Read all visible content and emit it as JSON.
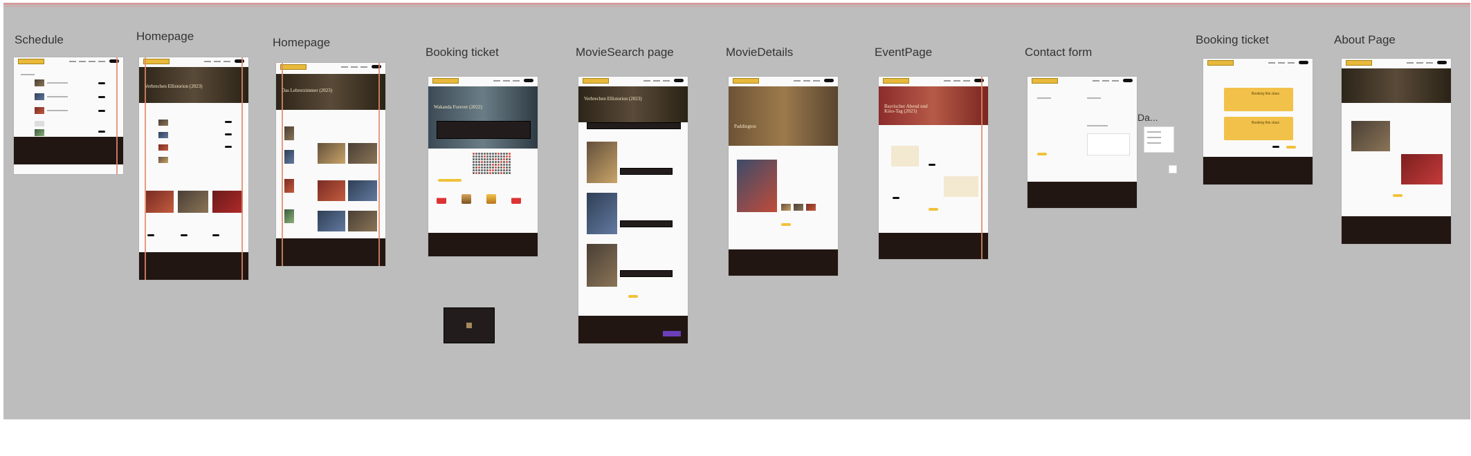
{
  "canvas": {
    "background": "#bdbdbd",
    "guide_color": "#e08a6a",
    "accent": "#f0c23a",
    "footer_color": "#221613"
  },
  "frames": [
    {
      "id": "schedule",
      "label": "Schedule"
    },
    {
      "id": "homepage-1",
      "label": "Homepage"
    },
    {
      "id": "homepage-2",
      "label": "Homepage"
    },
    {
      "id": "booking-1",
      "label": "Booking ticket"
    },
    {
      "id": "movie-search",
      "label": "MovieSearch page"
    },
    {
      "id": "movie-details",
      "label": "MovieDetails"
    },
    {
      "id": "event-page",
      "label": "EventPage"
    },
    {
      "id": "contact-form",
      "label": "Contact form"
    },
    {
      "id": "data",
      "label": "Da..."
    },
    {
      "id": "booking-2",
      "label": "Booking ticket"
    },
    {
      "id": "about",
      "label": "About Page"
    }
  ],
  "hero_titles": {
    "homepage_1": "Verbrechen Ellistorion (2023)",
    "homepage_2": "Das Lehrerzimmer (2023)",
    "booking_1": "Wakanda Forever (2022)",
    "movie_search": "Verbrechen Ellistorion (2023)",
    "movie_details": "Paddington",
    "event_page": "Bayrischer Abend und Kino-Tag (2023)"
  },
  "booking_2_tickets": [
    "Booking this class",
    "Booking this class"
  ],
  "icons": {
    "logo": "cinema-logo-icon",
    "play": "play-icon"
  }
}
